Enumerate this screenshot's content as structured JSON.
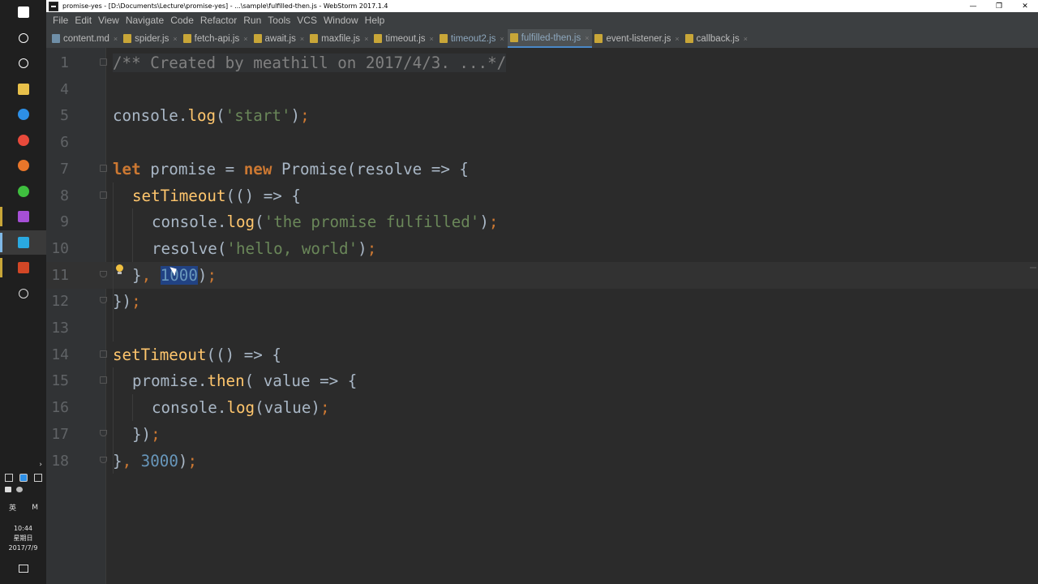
{
  "window": {
    "title": "promise-yes - [D:\\Documents\\Lecture\\promise-yes] - ...\\sample\\fulfilled-then.js - WebStorm 2017.1.4",
    "controls": [
      "minimize-icon",
      "restore-icon",
      "close-icon"
    ]
  },
  "menu": {
    "items": [
      "File",
      "Edit",
      "View",
      "Navigate",
      "Code",
      "Refactor",
      "Run",
      "Tools",
      "VCS",
      "Window",
      "Help"
    ]
  },
  "tabs": [
    {
      "label": "content.md",
      "icon_color": "#6f8fa8",
      "active": false,
      "dimmed": false
    },
    {
      "label": "spider.js",
      "icon_color": "#c8a638",
      "active": false,
      "dimmed": false
    },
    {
      "label": "fetch-api.js",
      "icon_color": "#c8a638",
      "active": false,
      "dimmed": false
    },
    {
      "label": "await.js",
      "icon_color": "#c8a638",
      "active": false,
      "dimmed": false
    },
    {
      "label": "maxfile.js",
      "icon_color": "#c8a638",
      "active": false,
      "dimmed": false
    },
    {
      "label": "timeout.js",
      "icon_color": "#c8a638",
      "active": false,
      "dimmed": false
    },
    {
      "label": "timeout2.js",
      "icon_color": "#c8a638",
      "active": false,
      "dimmed": true
    },
    {
      "label": "fulfilled-then.js",
      "icon_color": "#c8a638",
      "active": true,
      "dimmed": true
    },
    {
      "label": "event-listener.js",
      "icon_color": "#c8a638",
      "active": false,
      "dimmed": false
    },
    {
      "label": "callback.js",
      "icon_color": "#c8a638",
      "active": false,
      "dimmed": false
    }
  ],
  "editor": {
    "current_line": "11",
    "lines": [
      {
        "n": "1",
        "indent": 0,
        "fold": "start",
        "tokens": [
          {
            "t": "/** Created by meathill on 2017/4/3. ...*/",
            "c": "cm"
          }
        ]
      },
      {
        "n": "4",
        "indent": 0,
        "fold": "",
        "tokens": []
      },
      {
        "n": "5",
        "indent": 0,
        "fold": "",
        "tokens": [
          {
            "t": "console",
            "c": "pl"
          },
          {
            "t": ".",
            "c": "pl"
          },
          {
            "t": "log",
            "c": "fn"
          },
          {
            "t": "(",
            "c": "pl"
          },
          {
            "t": "'start'",
            "c": "st"
          },
          {
            "t": ")",
            "c": "pl"
          },
          {
            "t": ";",
            "c": "pu"
          }
        ]
      },
      {
        "n": "6",
        "indent": 0,
        "fold": "",
        "tokens": []
      },
      {
        "n": "7",
        "indent": 0,
        "fold": "start",
        "tokens": [
          {
            "t": "let",
            "c": "kw"
          },
          {
            "t": " promise = ",
            "c": "pl"
          },
          {
            "t": "new",
            "c": "kw"
          },
          {
            "t": " Promise(resolve => {",
            "c": "pl"
          }
        ]
      },
      {
        "n": "8",
        "indent": 1,
        "fold": "start",
        "tokens": [
          {
            "t": "setTimeout",
            "c": "fn"
          },
          {
            "t": "(() => {",
            "c": "pl"
          }
        ]
      },
      {
        "n": "9",
        "indent": 2,
        "fold": "",
        "tokens": [
          {
            "t": "console",
            "c": "pl"
          },
          {
            "t": ".",
            "c": "pl"
          },
          {
            "t": "log",
            "c": "fn"
          },
          {
            "t": "(",
            "c": "pl"
          },
          {
            "t": "'the promise fulfilled'",
            "c": "st"
          },
          {
            "t": ")",
            "c": "pl"
          },
          {
            "t": ";",
            "c": "pu"
          }
        ]
      },
      {
        "n": "10",
        "indent": 2,
        "fold": "",
        "tokens": [
          {
            "t": "resolve(",
            "c": "pl"
          },
          {
            "t": "'hello, world'",
            "c": "st"
          },
          {
            "t": ")",
            "c": "pl"
          },
          {
            "t": ";",
            "c": "pu"
          }
        ]
      },
      {
        "n": "11",
        "indent": 1,
        "fold": "end",
        "tokens": [
          {
            "t": "}",
            "c": "pl"
          },
          {
            "t": ", ",
            "c": "pu"
          },
          {
            "t": "1000",
            "c": "sel"
          },
          {
            "t": ")",
            "c": "pl"
          },
          {
            "t": ";",
            "c": "pu"
          }
        ]
      },
      {
        "n": "12",
        "indent": 0,
        "fold": "end",
        "tokens": [
          {
            "t": "})",
            "c": "pl"
          },
          {
            "t": ";",
            "c": "pu"
          }
        ]
      },
      {
        "n": "13",
        "indent": 0,
        "fold": "",
        "tokens": []
      },
      {
        "n": "14",
        "indent": 0,
        "fold": "start",
        "tokens": [
          {
            "t": "setTimeout",
            "c": "fn"
          },
          {
            "t": "(() => {",
            "c": "pl"
          }
        ]
      },
      {
        "n": "15",
        "indent": 1,
        "fold": "start",
        "tokens": [
          {
            "t": "promise",
            "c": "pl"
          },
          {
            "t": ".",
            "c": "pl"
          },
          {
            "t": "then",
            "c": "fn"
          },
          {
            "t": "( value => {",
            "c": "pl"
          }
        ]
      },
      {
        "n": "16",
        "indent": 2,
        "fold": "",
        "tokens": [
          {
            "t": "console",
            "c": "pl"
          },
          {
            "t": ".",
            "c": "pl"
          },
          {
            "t": "log",
            "c": "fn"
          },
          {
            "t": "(value)",
            "c": "pl"
          },
          {
            "t": ";",
            "c": "pu"
          }
        ]
      },
      {
        "n": "17",
        "indent": 1,
        "fold": "end",
        "tokens": [
          {
            "t": "})",
            "c": "pl"
          },
          {
            "t": ";",
            "c": "pu"
          }
        ]
      },
      {
        "n": "18",
        "indent": 0,
        "fold": "end",
        "tokens": [
          {
            "t": "}",
            "c": "pl"
          },
          {
            "t": ", ",
            "c": "pu"
          },
          {
            "t": "3000",
            "c": "nm"
          },
          {
            "t": ")",
            "c": "pl"
          },
          {
            "t": ";",
            "c": "pu"
          }
        ]
      }
    ]
  },
  "taskbar": {
    "apps": [
      {
        "name": "windows-start-icon",
        "color": "#ffffff",
        "shape": "sq"
      },
      {
        "name": "cortana-search-icon",
        "color": "#ffffff",
        "shape": "ring"
      },
      {
        "name": "task-view-icon",
        "color": "#ffffff",
        "shape": "ring"
      },
      {
        "name": "file-explorer-icon",
        "color": "#e8c04a",
        "shape": "sq"
      },
      {
        "name": "edge-browser-icon",
        "color": "#2d8fe6",
        "shape": "circ"
      },
      {
        "name": "chrome-browser-icon",
        "color": "#e84a3b",
        "shape": "circ"
      },
      {
        "name": "firefox-browser-icon",
        "color": "#e8762a",
        "shape": "circ"
      },
      {
        "name": "wechat-icon",
        "color": "#3fbf3f",
        "shape": "circ"
      },
      {
        "name": "phpstorm-icon",
        "color": "#a64fd6",
        "shape": "sq"
      },
      {
        "name": "webstorm-icon",
        "color": "#2aa9e0",
        "shape": "sq"
      },
      {
        "name": "powerpoint-icon",
        "color": "#d24726",
        "shape": "sq"
      },
      {
        "name": "clock-app-icon",
        "color": "#dddddd",
        "shape": "ring"
      }
    ],
    "tray_row1": [
      "network-icon",
      "bluetooth-icon",
      "volume-icon"
    ],
    "tray_row2": [
      "telegram-icon",
      "wechat-tray-icon"
    ],
    "ime_left": "英",
    "ime_right": "M",
    "time": "10:44",
    "weekday": "星期日",
    "date": "2017/7/9"
  },
  "colors": {
    "editor_bg": "#2b2b2b",
    "keyword": "#cc7832",
    "string": "#6a8759",
    "number": "#6897bb",
    "function": "#ffc66d",
    "plain": "#a9b7c6",
    "selection": "#214283"
  }
}
